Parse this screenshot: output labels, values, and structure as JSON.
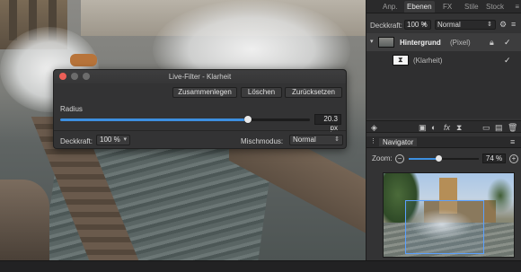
{
  "dialog": {
    "title": "Live-Filter - Klarheit",
    "buttons": {
      "merge": "Zusammenlegen",
      "delete": "Löschen",
      "reset": "Zurücksetzen"
    },
    "radius": {
      "label": "Radius",
      "value": "20.3 px",
      "fraction": 0.75
    },
    "opacity": {
      "label": "Deckkraft:",
      "value": "100 %"
    },
    "blend": {
      "label": "Mischmodus:",
      "value": "Normal"
    }
  },
  "panel": {
    "tabs": [
      "Anp.",
      "Ebenen",
      "FX",
      "Stile",
      "Stock"
    ],
    "active_tab": "Ebenen",
    "opacity_label": "Deckkraft:",
    "opacity_value": "100 %",
    "blend_value": "Normal",
    "layers": [
      {
        "name": "Hintergrund",
        "suffix": "(Pixel)",
        "checked": true
      },
      {
        "name": "(Klarheit)",
        "checked": true
      }
    ]
  },
  "navigator": {
    "title": "Navigator",
    "zoom_label": "Zoom:",
    "zoom_value": "74 %",
    "zoom_fraction": 0.42
  },
  "icons": [
    "minus-icon",
    "plus-icon",
    "lock-icon",
    "settings-icon",
    "menu-icon",
    "fx-icon",
    "folder-icon",
    "trash-icon",
    "layers-icon",
    "mask-icon"
  ],
  "colors": {
    "accent": "#3d8fe0",
    "close": "#ec5f57"
  }
}
